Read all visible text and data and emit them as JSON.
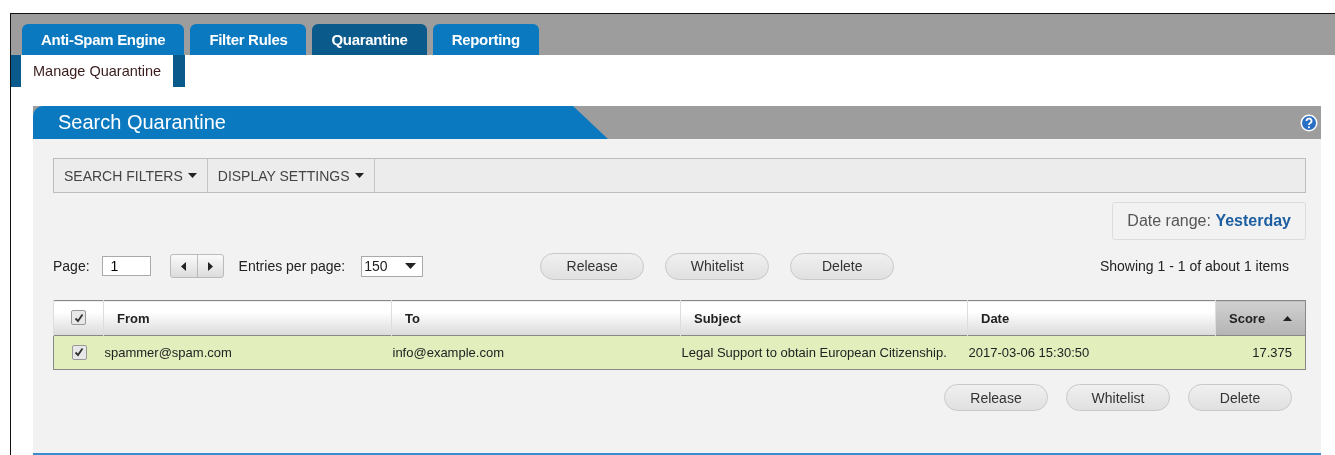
{
  "tabs": [
    {
      "label": "Anti-Spam Engine",
      "selected": false
    },
    {
      "label": "Filter Rules",
      "selected": false
    },
    {
      "label": "Quarantine",
      "selected": true
    },
    {
      "label": "Reporting",
      "selected": false
    }
  ],
  "subtabs": [
    {
      "label": "Manage Quarantine",
      "selected": true
    }
  ],
  "panel": {
    "title": "Search Quarantine"
  },
  "menus": [
    "SEARCH FILTERS",
    "DISPLAY SETTINGS"
  ],
  "date_range": {
    "label": "Date range:",
    "value": "Yesterday"
  },
  "pager": {
    "page_label": "Page:",
    "page": "1",
    "entries_label": "Entries per page:",
    "entries": "150"
  },
  "actions_top": [
    "Release",
    "Whitelist",
    "Delete"
  ],
  "showing": "Showing 1 - 1 of about 1 items",
  "table": {
    "select_all_checked": true,
    "columns": [
      {
        "label": "From",
        "sorted": false
      },
      {
        "label": "To",
        "sorted": false
      },
      {
        "label": "Subject",
        "sorted": false
      },
      {
        "label": "Date",
        "sorted": false
      },
      {
        "label": "Score",
        "sorted": true
      }
    ],
    "rows": [
      {
        "checked": true,
        "selected": true,
        "cells": [
          "spammer@spam.com",
          "info@example.com",
          "Legal Support to obtain European Citizenship.",
          "2017-03-06 15:30:50",
          "17.375"
        ]
      }
    ]
  },
  "actions_bottom": [
    "Release",
    "Whitelist",
    "Delete"
  ]
}
